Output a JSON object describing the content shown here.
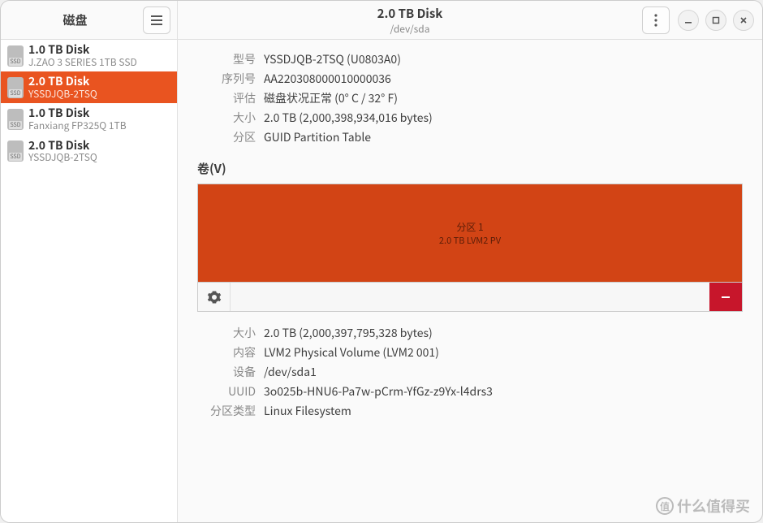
{
  "header": {
    "sidebar_title": "磁盘",
    "title": "2.0 TB Disk",
    "subtitle": "/dev/sda"
  },
  "sidebar": {
    "items": [
      {
        "title": "1.0 TB Disk",
        "sub": "J.ZAO 3 SERIES 1TB SSD",
        "selected": false
      },
      {
        "title": "2.0 TB Disk",
        "sub": "YSSDJQB-2TSQ",
        "selected": true
      },
      {
        "title": "1.0 TB Disk",
        "sub": "Fanxiang FP325Q 1TB",
        "selected": false
      },
      {
        "title": "2.0 TB Disk",
        "sub": "YSSDJQB-2TSQ",
        "selected": false
      }
    ]
  },
  "disk_info": {
    "labels": {
      "model": "型号",
      "serial": "序列号",
      "assessment": "评估",
      "size": "大小",
      "partitioning": "分区"
    },
    "model": "YSSDJQB-2TSQ (U0803A0)",
    "serial": "AA220308000010000036",
    "assessment": "磁盘状况正常 (0° C / 32° F)",
    "size": "2.0 TB (2,000,398,934,016 bytes)",
    "partitioning": "GUID Partition Table"
  },
  "volumes": {
    "section_title": "卷(V)",
    "partition": {
      "title": "分区 1",
      "sub": "2.0 TB LVM2 PV"
    }
  },
  "volume_details": {
    "labels": {
      "size": "大小",
      "contents": "内容",
      "device": "设备",
      "uuid": "UUID",
      "ptype": "分区类型"
    },
    "size": "2.0 TB (2,000,397,795,328 bytes)",
    "contents": "LVM2 Physical Volume (LVM2 001)",
    "device": "/dev/sda1",
    "uuid": "3o025b-HNU6-Pa7w-pCrm-YfGz-z9Yx-l4drs3",
    "ptype": "Linux Filesystem"
  },
  "watermark": "什么值得买"
}
